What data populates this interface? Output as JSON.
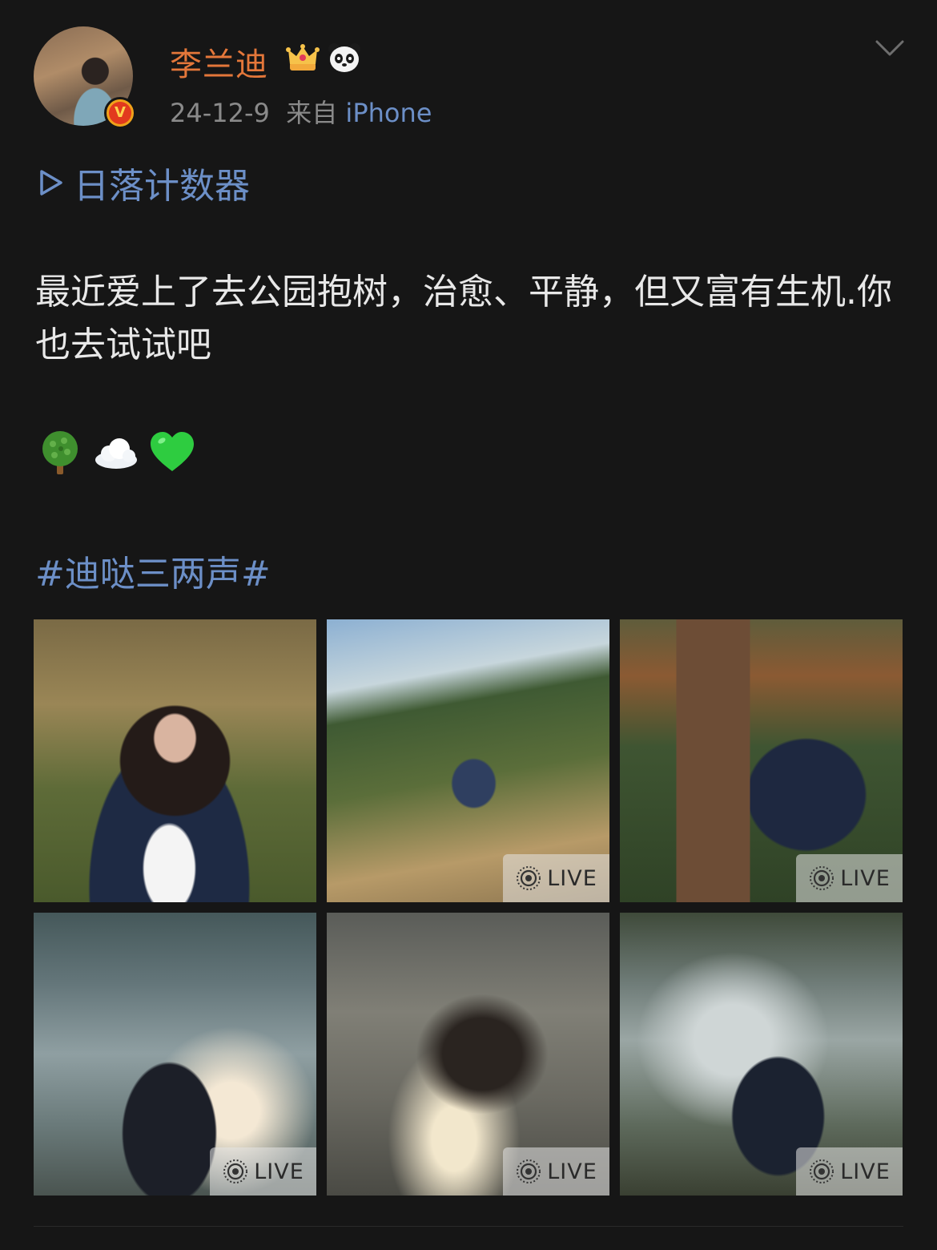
{
  "user": {
    "name": "李兰迪",
    "timestamp": "24-12-9",
    "source_prefix": "来自",
    "source": "iPhone",
    "badges": [
      "crown-icon",
      "panda-icon"
    ],
    "verified": "V"
  },
  "post": {
    "playlist_label": "日落计数器",
    "text": "最近爱上了去公园抱树，治愈、平静，但又富有生机.你也去试试吧",
    "emojis": [
      "tree-icon",
      "cloud-icon",
      "green-heart-icon"
    ],
    "hashtag": "#迪哒三两声#"
  },
  "photos": [
    {
      "live": false
    },
    {
      "live": true,
      "label": "LIVE"
    },
    {
      "live": true,
      "label": "LIVE"
    },
    {
      "live": true,
      "label": "LIVE"
    },
    {
      "live": true,
      "label": "LIVE"
    },
    {
      "live": true,
      "label": "LIVE"
    }
  ],
  "colors": {
    "background": "#161616",
    "username": "#e4773a",
    "link": "#6c8fc7",
    "meta": "#8a8a8a"
  }
}
